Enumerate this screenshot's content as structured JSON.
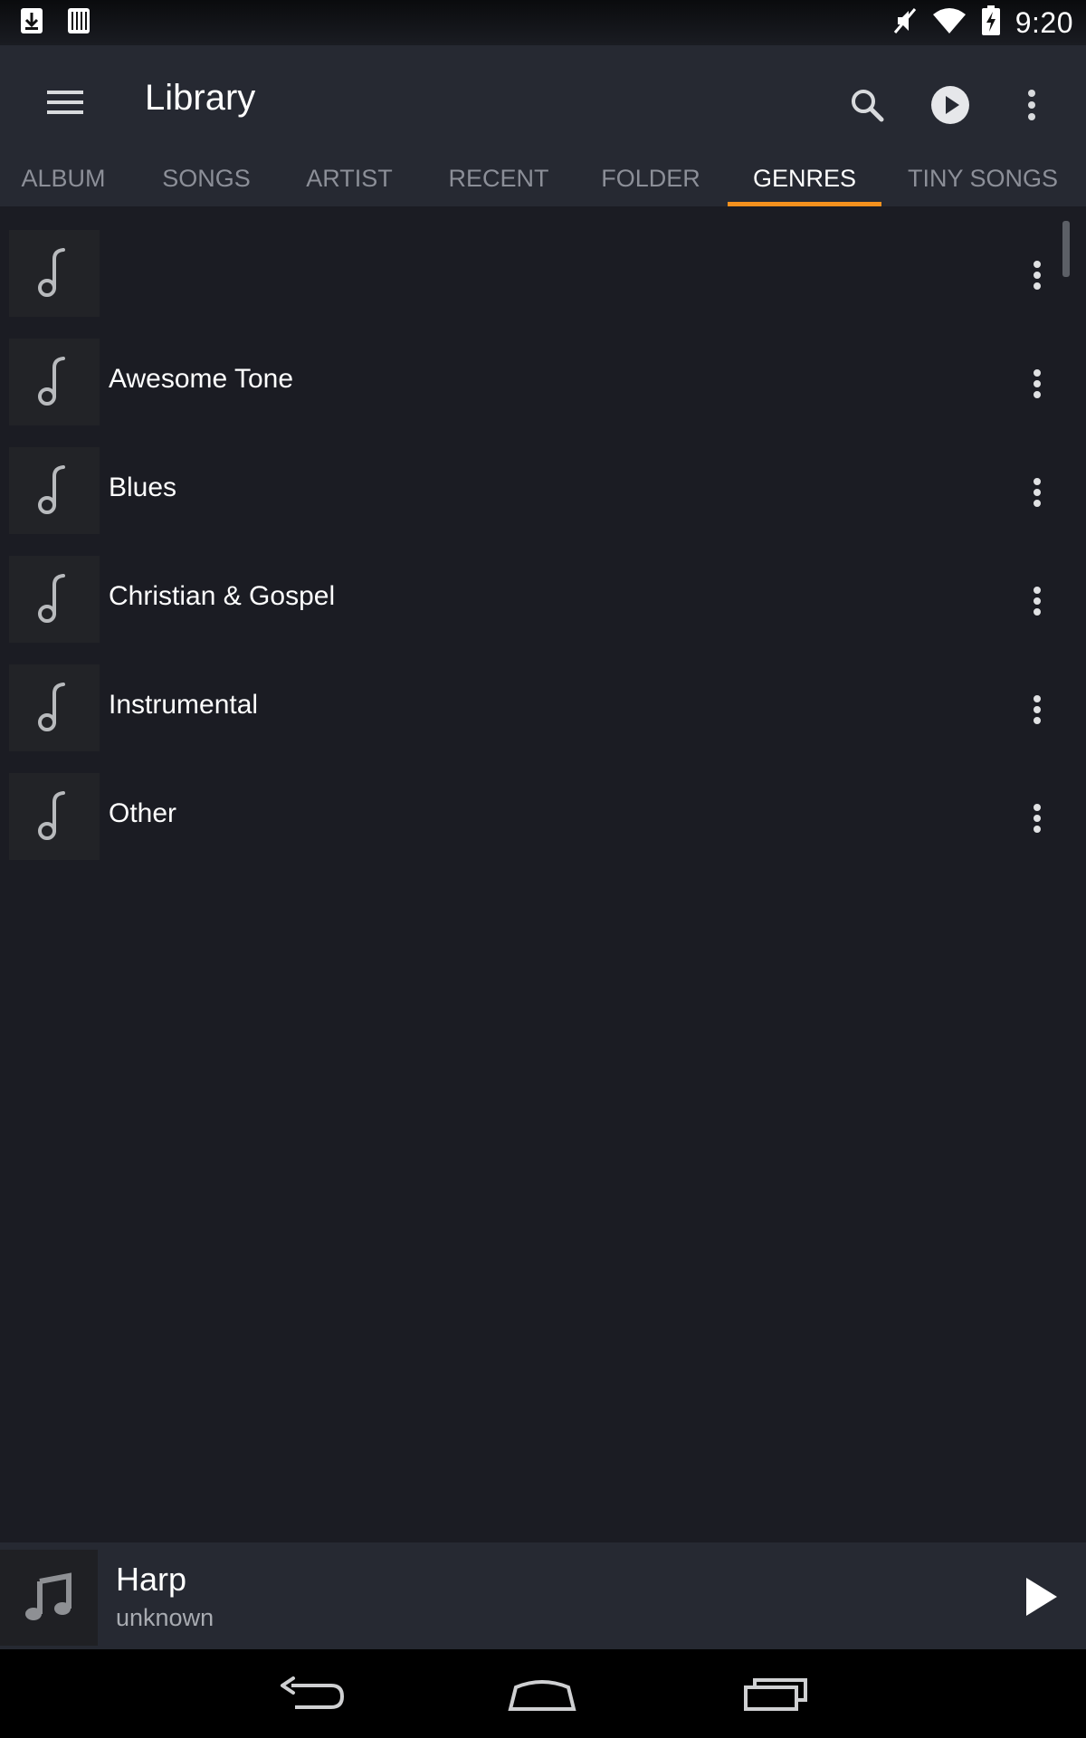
{
  "status_bar": {
    "time": "9:20",
    "left_icons": [
      "download-icon",
      "barcode-icon"
    ],
    "right_icons": [
      "mute-icon",
      "wifi-icon",
      "battery-charging-icon"
    ]
  },
  "app_bar": {
    "title": "Library",
    "actions": [
      "search-icon",
      "play-circle-icon",
      "more-vert-icon"
    ]
  },
  "tabs": [
    {
      "label": "ALBUM",
      "active": false
    },
    {
      "label": "SONGS",
      "active": false
    },
    {
      "label": "ARTIST",
      "active": false
    },
    {
      "label": "RECENT",
      "active": false
    },
    {
      "label": "FOLDER",
      "active": false
    },
    {
      "label": "GENRES",
      "active": true
    },
    {
      "label": "TINY SONGS",
      "active": false
    }
  ],
  "genres": [
    {
      "label": ""
    },
    {
      "label": "Awesome Tone"
    },
    {
      "label": "Blues"
    },
    {
      "label": "Christian & Gospel"
    },
    {
      "label": "Instrumental"
    },
    {
      "label": "Other"
    }
  ],
  "mini_player": {
    "title": "Harp",
    "subtitle": "unknown"
  },
  "nav_bar": [
    "back-icon",
    "home-icon",
    "recents-icon"
  ],
  "colors": {
    "accent": "#f5911e",
    "background": "#1b1c23",
    "app_bar": "#262932"
  }
}
